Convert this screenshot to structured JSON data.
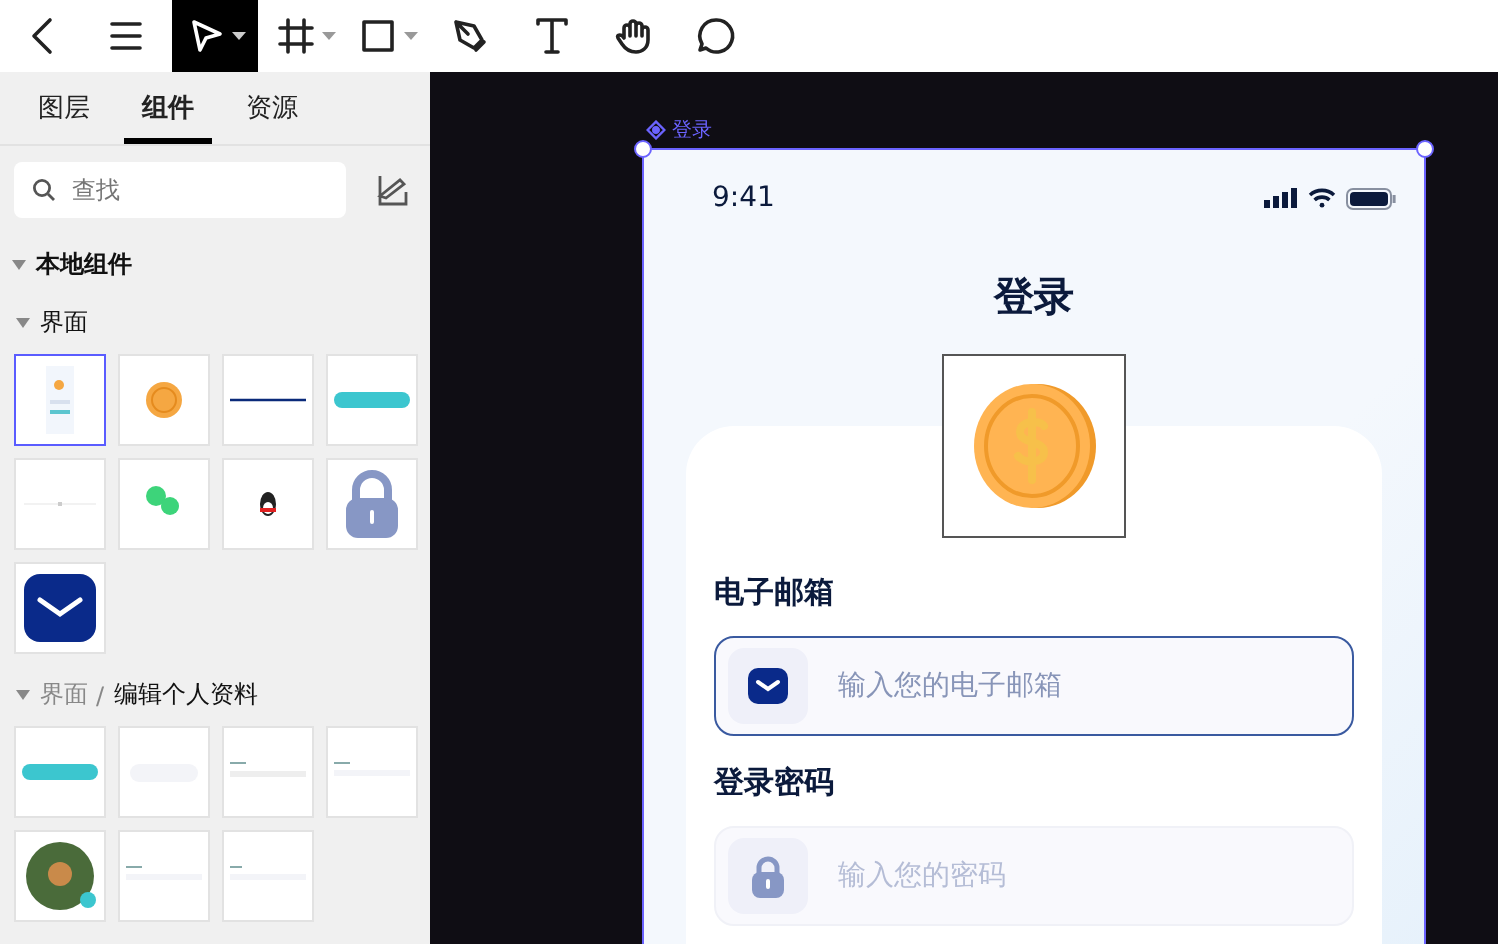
{
  "toolbar": {
    "tools": [
      {
        "kind": "back",
        "selected": false,
        "dropdown": false
      },
      {
        "kind": "menu",
        "selected": false,
        "dropdown": false
      },
      {
        "kind": "pointer",
        "selected": true,
        "dropdown": true
      },
      {
        "kind": "frame",
        "selected": false,
        "dropdown": true
      },
      {
        "kind": "rectangle",
        "selected": false,
        "dropdown": true
      },
      {
        "kind": "pen",
        "selected": false,
        "dropdown": false
      },
      {
        "kind": "text",
        "selected": false,
        "dropdown": false
      },
      {
        "kind": "hand",
        "selected": false,
        "dropdown": false
      },
      {
        "kind": "comment",
        "selected": false,
        "dropdown": false
      }
    ]
  },
  "sidebar": {
    "tabs": [
      {
        "label": "图层",
        "selected": false
      },
      {
        "label": "组件",
        "selected": true
      },
      {
        "label": "资源",
        "selected": false
      }
    ],
    "search": {
      "placeholder": "查找"
    },
    "section": {
      "title": "本地组件",
      "expanded": true,
      "groups": [
        {
          "path": [
            "界面"
          ],
          "expanded": true,
          "items": [
            {
              "kind": "screen",
              "selected": true
            },
            {
              "kind": "coin",
              "selected": false
            },
            {
              "kind": "line",
              "selected": false
            },
            {
              "kind": "pill",
              "selected": false
            },
            {
              "kind": "dot",
              "selected": false
            },
            {
              "kind": "chat",
              "selected": false
            },
            {
              "kind": "penguin",
              "selected": false
            },
            {
              "kind": "lock",
              "selected": false
            },
            {
              "kind": "mail",
              "selected": false
            }
          ]
        },
        {
          "path": [
            "界面",
            "编辑个人资料"
          ],
          "separator": "/",
          "expanded": true,
          "items": [
            {
              "kind": "pill",
              "selected": false
            },
            {
              "kind": "ghost",
              "selected": false
            },
            {
              "kind": "form",
              "selected": false
            },
            {
              "kind": "input",
              "selected": false
            },
            {
              "kind": "avatar",
              "selected": false
            },
            {
              "kind": "input",
              "selected": false
            },
            {
              "kind": "select",
              "selected": false
            }
          ]
        }
      ]
    }
  },
  "canvas": {
    "frame": {
      "label": "登录",
      "selected": true,
      "status_bar": {
        "time": "9:41"
      },
      "title": "登录",
      "fields": [
        {
          "label": "电子邮箱",
          "placeholder": "输入您的电子邮箱",
          "kind": "email",
          "focused": true
        },
        {
          "label": "登录密码",
          "placeholder": "输入您的密码",
          "kind": "password",
          "focused": false
        }
      ]
    }
  }
}
